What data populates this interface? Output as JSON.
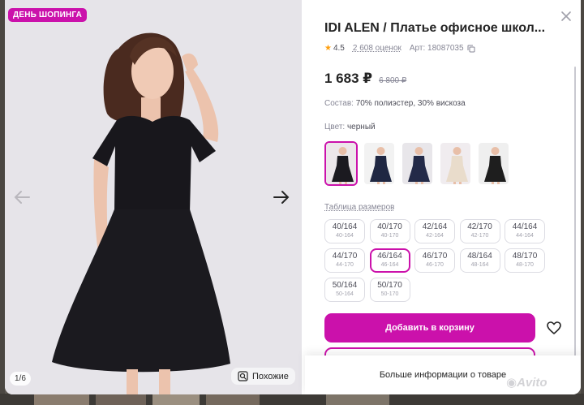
{
  "promo_badge": "ДЕНЬ ШОПИНГА",
  "gallery": {
    "counter": "1/6",
    "similar_label": "Похожие"
  },
  "product": {
    "title": "IDI ALEN / Платье офисное школ...",
    "rating": "4.5",
    "reviews": "2 608 оценок",
    "article": "Арт: 18087035",
    "price": "1 683 ₽",
    "old_price": "6 800 ₽",
    "composition_label": "Состав:",
    "composition_value": "70% полиэстер, 30% вискоза",
    "color_label": "Цвет:",
    "color_value": "черный"
  },
  "swatches": [
    {
      "name": "black",
      "dress": "#1b1a20",
      "bg": "#ece7ea"
    },
    {
      "name": "navy-sleeves",
      "dress": "#1f2742",
      "bg": "#f2f2f2"
    },
    {
      "name": "navy",
      "dress": "#232a48",
      "bg": "#e8e6ea"
    },
    {
      "name": "beige",
      "dress": "#e9dccb",
      "bg": "#f0ecef"
    },
    {
      "name": "black-long",
      "dress": "#1e1e1e",
      "bg": "#efefef"
    }
  ],
  "size_table_label": "Таблица размеров",
  "sizes": [
    {
      "a": "40/164",
      "b": "40-164"
    },
    {
      "a": "40/170",
      "b": "40-170"
    },
    {
      "a": "42/164",
      "b": "42-164"
    },
    {
      "a": "42/170",
      "b": "42-170"
    },
    {
      "a": "44/164",
      "b": "44-164"
    },
    {
      "a": "44/170",
      "b": "44-170"
    },
    {
      "a": "46/164",
      "b": "46-164"
    },
    {
      "a": "46/170",
      "b": "46-170"
    },
    {
      "a": "48/164",
      "b": "48-164"
    },
    {
      "a": "48/170",
      "b": "48-170"
    },
    {
      "a": "50/164",
      "b": "50-164"
    },
    {
      "a": "50/170",
      "b": "50-170"
    }
  ],
  "selected_size_index": 6,
  "add_to_cart": "Добавить в корзину",
  "more_info": "Больше информации о товаре",
  "watermark": "Avito",
  "colors": {
    "accent": "#cb11ab",
    "star": "#ff9f0e"
  }
}
